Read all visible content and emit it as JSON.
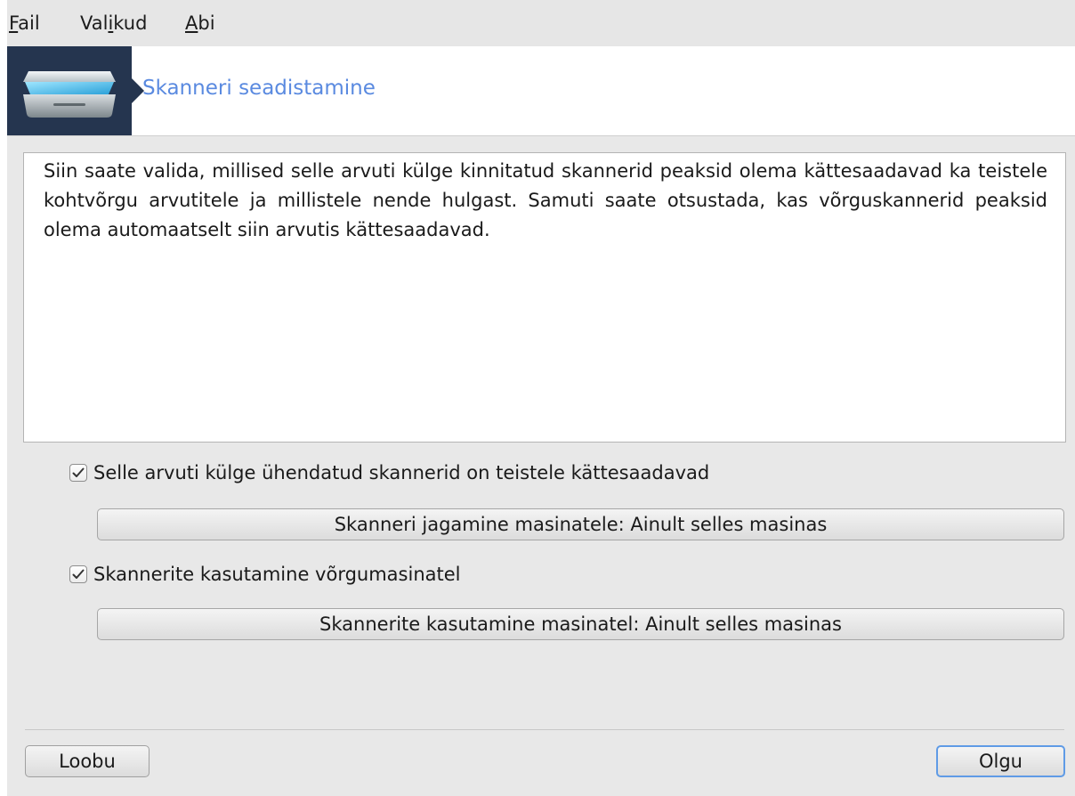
{
  "menu": {
    "items": [
      {
        "pre": "",
        "ul": "F",
        "post": "ail"
      },
      {
        "pre": "Val",
        "ul": "i",
        "post": "kud"
      },
      {
        "pre": "",
        "ul": "A",
        "post": "bi"
      }
    ]
  },
  "header": {
    "title": "Skanneri seadistamine",
    "icon": "scanner-icon",
    "banner_color": "#25354f",
    "title_color": "#5a8ae0"
  },
  "description": "Siin saate valida, millised selle arvuti külge kinnitatud skannerid peaksid olema kättesaadavad ka teistele kohtvõrgu arvutitele ja millistele nende hulgast. Samuti saate otsustada, kas võrguskannerid peaksid olema automaatselt siin arvutis kättesaadavad.",
  "options": {
    "share_local": {
      "label": "Selle arvuti külge ühendatud skannerid on teistele kättesaadavad",
      "checked": true,
      "button": "Skanneri jagamine masinatele: Ainult selles masinas"
    },
    "use_remote": {
      "label": "Skannerite kasutamine võrgumasinatel",
      "checked": true,
      "button": "Skannerite kasutamine masinatel: Ainult selles masinas"
    }
  },
  "buttons": {
    "cancel": "Loobu",
    "ok": "Olgu"
  },
  "colors": {
    "ok_focus_border": "#5f9be6"
  }
}
